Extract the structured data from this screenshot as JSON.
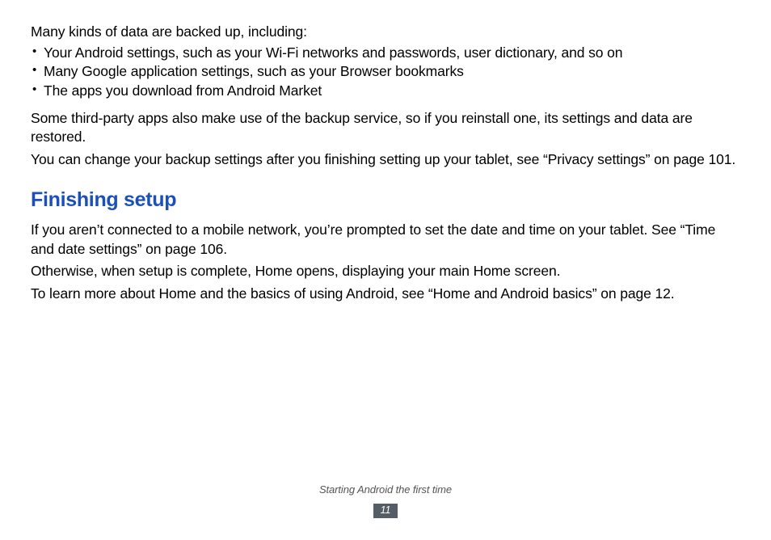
{
  "intro": "Many kinds of data are backed up, including:",
  "bullets": [
    "Your Android settings, such as your Wi-Fi networks and passwords, user dictionary, and so on",
    "Many Google application settings, such as your Browser bookmarks",
    "The apps you download from Android Market"
  ],
  "para1": "Some third-party apps also make use of the backup service, so if you reinstall one, its settings and data are restored.",
  "para2": "You can change your backup settings after you finishing setting up your tablet, see “Privacy settings” on page 101.",
  "heading": "Finishing setup",
  "para3": "If you aren’t connected to a mobile network, you’re prompted to set the date and time on your tablet. See “Time and date settings” on page 106.",
  "para4": "Otherwise, when setup is complete, Home opens, displaying your main Home screen.",
  "para5": "To learn more about Home and the basics of using Android, see “Home and Android basics” on page 12.",
  "footer_caption": "Starting Android the first time",
  "page_number": "11"
}
